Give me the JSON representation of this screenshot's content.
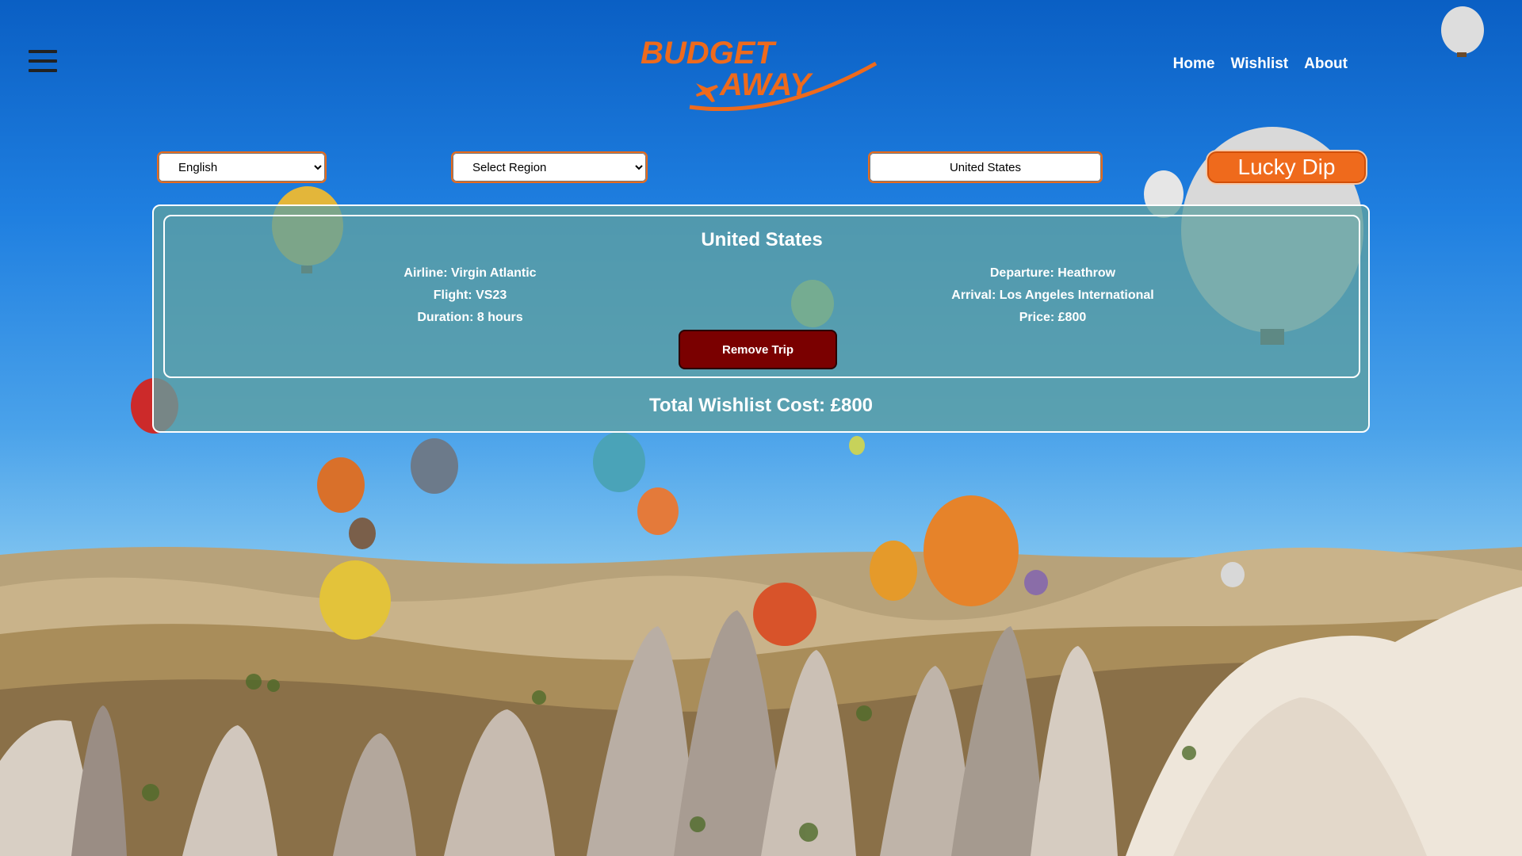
{
  "header": {
    "logo_top": "BUDGET",
    "logo_bottom": "AWAY",
    "nav": [
      "Home",
      "Wishlist",
      "About"
    ]
  },
  "controls": {
    "language": "English",
    "region": "Select Region",
    "country": "United States",
    "lucky_dip": "Lucky Dip"
  },
  "trip": {
    "title": "United States",
    "airline": "Airline: Virgin Atlantic",
    "flight": "Flight: VS23",
    "duration": "Duration: 8 hours",
    "departure": "Departure: Heathrow",
    "arrival": "Arrival: Los Angeles International",
    "price": "Price: £800",
    "remove_label": "Remove Trip"
  },
  "total": "Total Wishlist Cost: £800",
  "colors": {
    "brand_orange": "#ef6a1c",
    "remove_button": "#7a0000",
    "panel": "#5fa0a0"
  }
}
